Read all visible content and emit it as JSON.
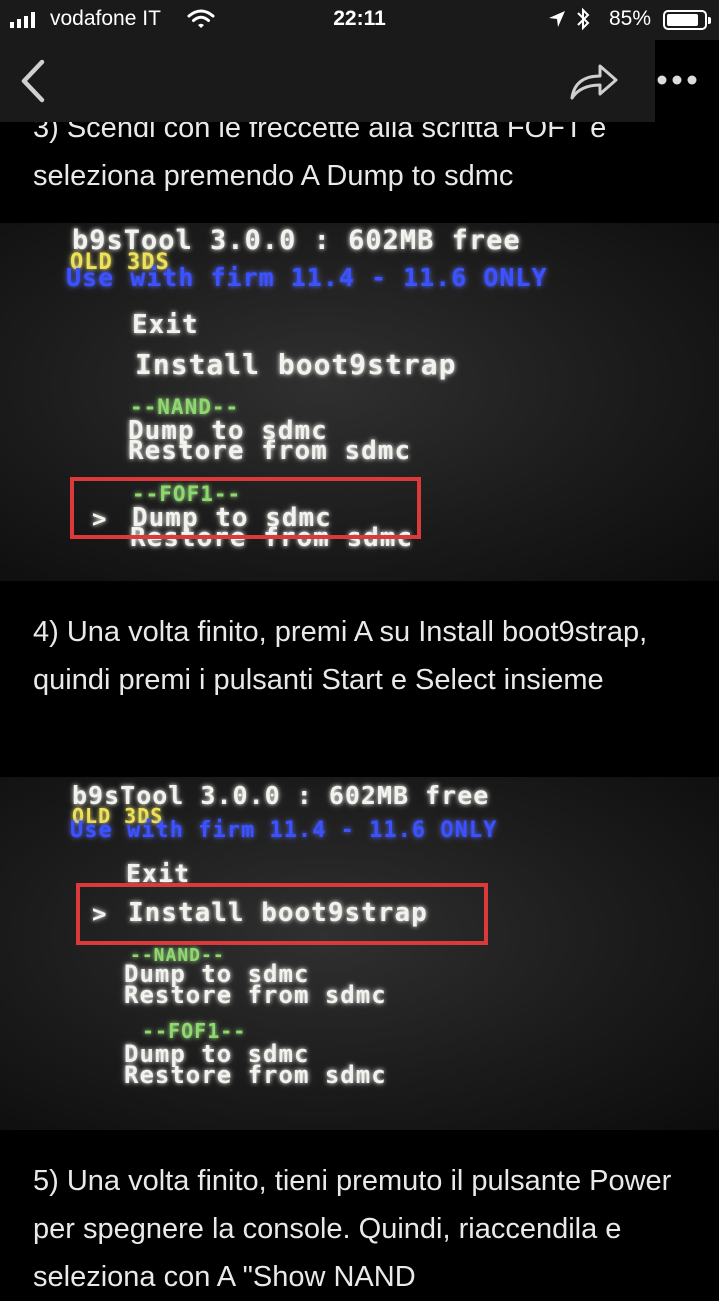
{
  "status_bar": {
    "carrier": "vodafone IT",
    "time": "22:11",
    "battery_percent": "85%",
    "battery_level": 0.85,
    "icons": [
      "signal-icon",
      "wifi-icon",
      "location-icon",
      "bluetooth-icon",
      "battery-icon"
    ]
  },
  "nav": {
    "back_icon": "chevron-left-icon",
    "share_icon": "share-arrow-icon",
    "more_icon": "more-dots-icon"
  },
  "article": {
    "step3": "3) Scendi con le freccette alla scritta FOFT e seleziona premendo A Dump to sdmc",
    "step4": "4) Una volta finito, premi A su Install boot9strap, quindi premi i pulsanti Start e Select insieme",
    "step5": "5) Una volta finito, tieni premuto il pulsante Power per spegnere la console. Quindi, riaccendila e seleziona con A \"Show NAND"
  },
  "photo1": {
    "header": "b9sTool 3.0.0 : 602MB free",
    "model": "OLD 3DS",
    "warning": "Use with firm 11.4 - 11.6 ONLY",
    "exit": "Exit",
    "install": "Install boot9strap",
    "nand_header": "--NAND--",
    "nand_dump": "Dump to sdmc",
    "nand_restore": "Restore from sdmc",
    "fof_header": "--FOF1--",
    "cursor": ">",
    "fof_dump": "Dump to sdmc",
    "fof_restore": "Restore from sdmc"
  },
  "photo2": {
    "header": "b9sTool 3.0.0 : 602MB free",
    "model": "OLD 3DS",
    "warning": "Use with firm 11.4 - 11.6 ONLY",
    "exit": "Exit",
    "cursor": ">",
    "install": "Install boot9strap",
    "nand_header": "--NAND--",
    "nand_dump": "Dump to sdmc",
    "nand_restore": "Restore from sdmc",
    "fof_header": "--FOF1--",
    "fof_dump": "Dump to sdmc",
    "fof_restore": "Restore from sdmc"
  },
  "colors": {
    "highlight_box": "#dc3a3a",
    "screen_white": "#f2f2ee",
    "screen_yellow": "#eee25a",
    "screen_blue": "#3c52ff",
    "screen_green": "#8fd870"
  }
}
